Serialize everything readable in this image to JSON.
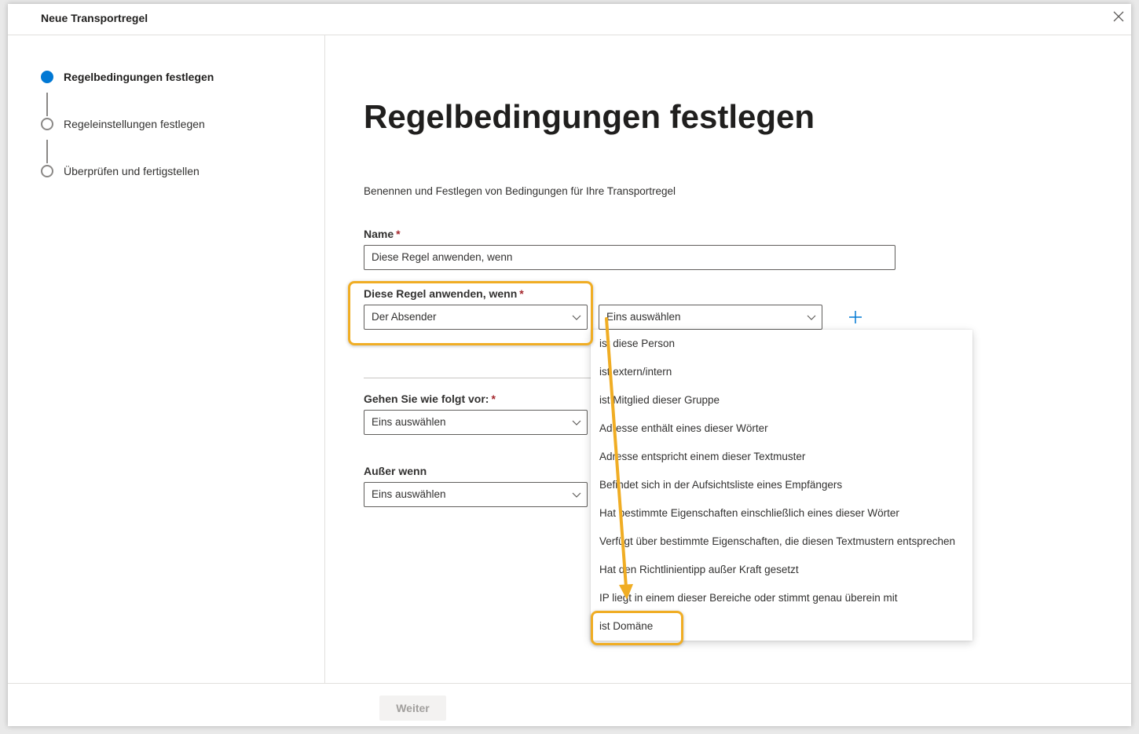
{
  "header": {
    "title": "Neue Transportregel"
  },
  "steps": [
    {
      "label": "Regelbedingungen festlegen",
      "state": "active"
    },
    {
      "label": "Regeleinstellungen festlegen",
      "state": "pending"
    },
    {
      "label": "Überprüfen und fertigstellen",
      "state": "pending"
    }
  ],
  "main": {
    "title": "Regelbedingungen festlegen",
    "description": "Benennen und Festlegen von Bedingungen für Ihre Transportregel",
    "name_label": "Name",
    "name_value": "Diese Regel anwenden, wenn",
    "apply_label": "Diese Regel anwenden, wenn",
    "apply_value": "Der Absender",
    "condition_placeholder": "Eins auswählen",
    "action_label": "Gehen Sie wie folgt vor:",
    "action_value": "Eins auswählen",
    "except_label": "Außer wenn",
    "except_value": "Eins auswählen",
    "required_mark": "*"
  },
  "menu": {
    "items": [
      "ist diese Person",
      "ist extern/intern",
      "ist Mitglied dieser Gruppe",
      "Adresse enthält eines dieser Wörter",
      "Adresse entspricht einem dieser Textmuster",
      "Befindet sich in der Aufsichtsliste eines Empfängers",
      "Hat bestimmte Eigenschaften einschließlich eines dieser Wörter",
      "Verfügt über bestimmte Eigenschaften, die diesen Textmustern entsprechen",
      "Hat den Richtlinientipp außer Kraft gesetzt",
      "IP liegt in einem dieser Bereiche oder stimmt genau überein mit",
      "ist Domäne"
    ],
    "highlighted_item": "ist Domäne"
  },
  "footer": {
    "next_label": "Weiter",
    "next_enabled": false
  },
  "colors": {
    "accent": "#0078d4",
    "annotation": "#f0ad24",
    "required": "#a4262c"
  },
  "icons": {
    "close": "close-icon",
    "chevron": "chevron-down-icon",
    "add": "plus-icon"
  }
}
